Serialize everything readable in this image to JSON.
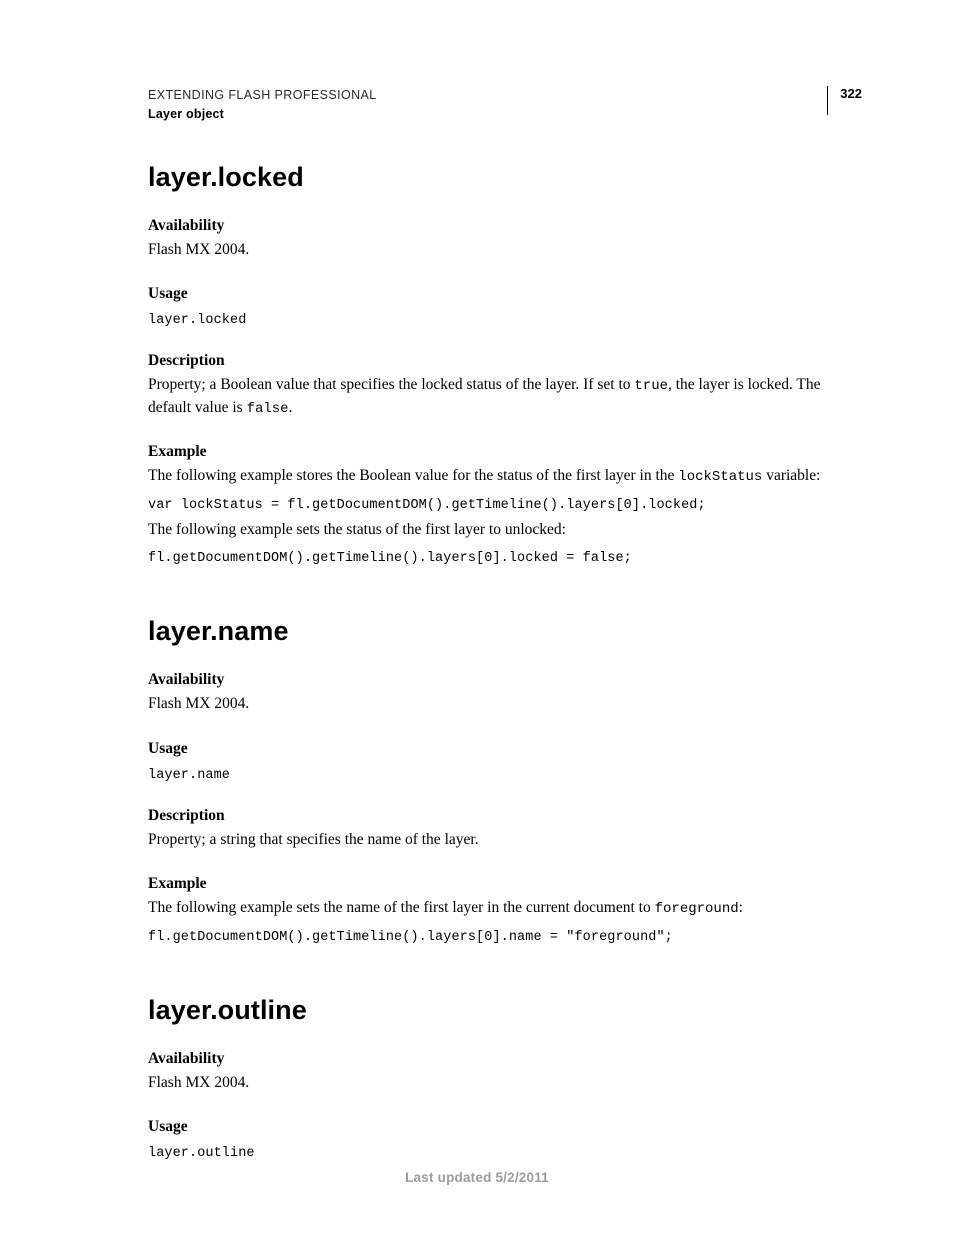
{
  "header": {
    "title": "EXTENDING FLASH PROFESSIONAL",
    "subtitle": "Layer object",
    "page_number": "322"
  },
  "sections": [
    {
      "heading": "layer.locked",
      "availability_label": "Availability",
      "availability_text": "Flash MX 2004.",
      "usage_label": "Usage",
      "usage_code": "layer.locked",
      "description_label": "Description",
      "description_parts": {
        "pre": "Property; a Boolean value that specifies the locked status of the layer. If set to ",
        "code1": "true",
        "mid": ", the layer is locked. The default value is ",
        "code2": "false",
        "post": "."
      },
      "example_label": "Example",
      "example_intro1_pre": "The following example stores the Boolean value for the status of the first layer in the ",
      "example_intro1_code": "lockStatus",
      "example_intro1_post": " variable:",
      "example_code1": "var lockStatus = fl.getDocumentDOM().getTimeline().layers[0].locked;",
      "example_intro2": "The following example sets the status of the first layer to unlocked:",
      "example_code2": "fl.getDocumentDOM().getTimeline().layers[0].locked = false;"
    },
    {
      "heading": "layer.name",
      "availability_label": "Availability",
      "availability_text": "Flash MX 2004.",
      "usage_label": "Usage",
      "usage_code": "layer.name",
      "description_label": "Description",
      "description_text": "Property; a string that specifies the name of the layer.",
      "example_label": "Example",
      "example_intro_pre": "The following example sets the name of the first layer in the current document to ",
      "example_intro_code": "foreground",
      "example_intro_post": ":",
      "example_code": "fl.getDocumentDOM().getTimeline().layers[0].name = \"foreground\";"
    },
    {
      "heading": "layer.outline",
      "availability_label": "Availability",
      "availability_text": "Flash MX 2004.",
      "usage_label": "Usage",
      "usage_code": "layer.outline"
    }
  ],
  "footer": "Last updated 5/2/2011"
}
